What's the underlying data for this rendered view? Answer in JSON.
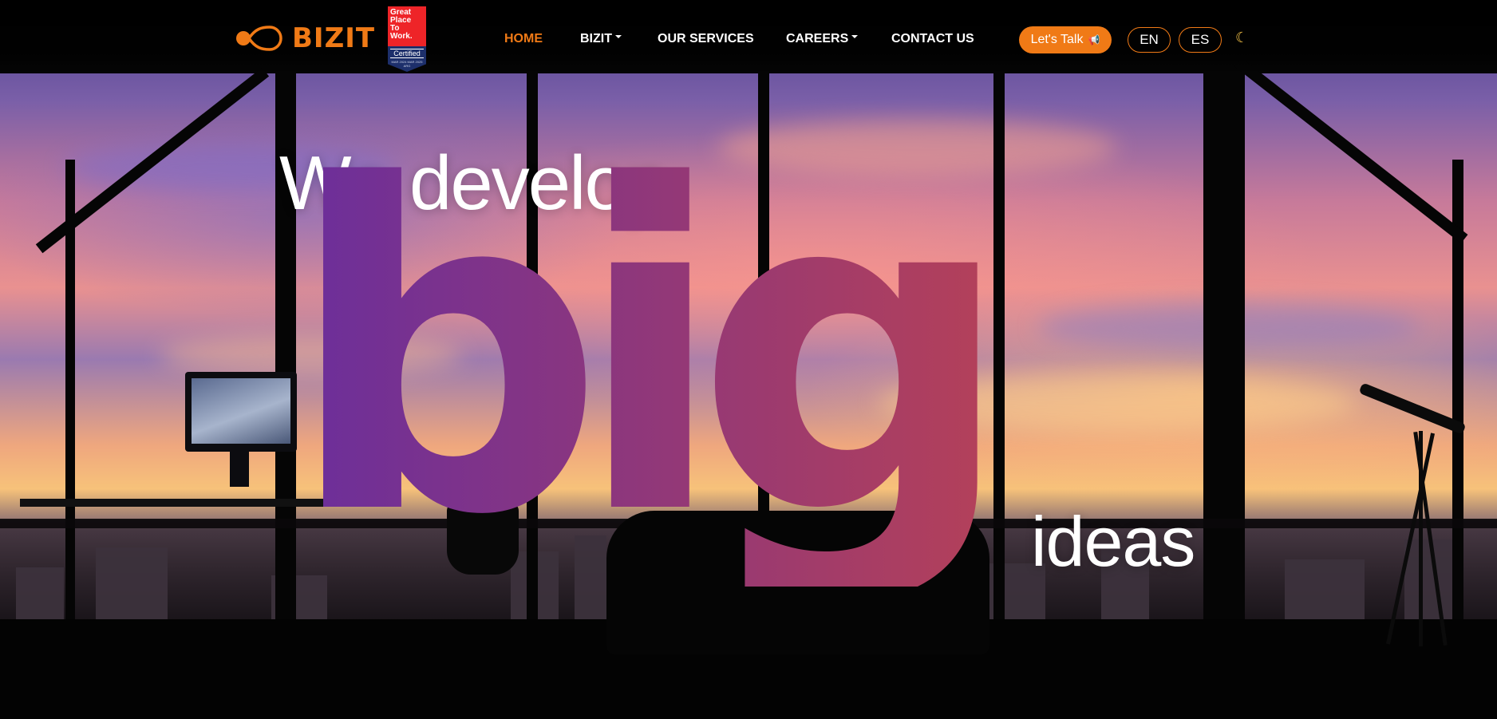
{
  "brand": {
    "name": "BIZIT",
    "color": "#f07a16"
  },
  "badge": {
    "line1": "Great",
    "line2": "Place",
    "line3": "To",
    "line4": "Work.",
    "certified": "Certified",
    "dates": "MAR 2024 MAR 2025 ARG"
  },
  "nav": {
    "home": "HOME",
    "bizit": "BIZIT",
    "services": "OUR SERVICES",
    "careers": "CAREERS",
    "contact": "CONTACT US",
    "talk": "Let's Talk",
    "talk_icon": "megaphone-icon",
    "lang_en": "EN",
    "lang_es": "ES",
    "theme_icon": "moon-icon"
  },
  "hero": {
    "line1": "We develop",
    "big": "big",
    "last": "ideas",
    "gradient_start": "#6a2e9c",
    "gradient_end": "#b3405a"
  }
}
